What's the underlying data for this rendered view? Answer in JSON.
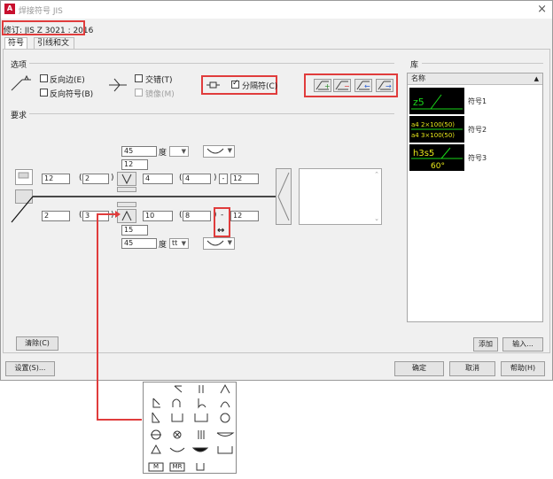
{
  "window": {
    "title": "焊接符号 JIS",
    "app_icon": "A",
    "close": "×"
  },
  "revision": "修订: JIS Z 3021 : 2016",
  "tabs": [
    {
      "label": "符号"
    },
    {
      "label": "引线和文字"
    }
  ],
  "options": {
    "heading": "选项",
    "reverse_side": "反向边(E)",
    "reverse_symbol": "反向符号(B)",
    "staggered": "交错(T)",
    "mirror": "镜像(M)",
    "separator": "分隔符(C)"
  },
  "requirements": {
    "heading": "要求",
    "upper": {
      "angle": "45",
      "angle_unit": "度",
      "root_gap": "12",
      "depth": "12",
      "size": "2",
      "length": "4",
      "dash": "-",
      "pitch": "12"
    },
    "lower": {
      "depth": "2",
      "size": "3",
      "length": "10",
      "pitch_count": "8",
      "dash": "-",
      "pitch": "12",
      "root_gap": "15",
      "angle": "45",
      "angle_unit": "度",
      "finish": "tt",
      "arrow_label": "↔"
    },
    "clear_button": "清除(C)"
  },
  "library": {
    "heading": "库",
    "column": "名称",
    "items": [
      {
        "name": "符号1",
        "line1": "z5",
        "line2": ""
      },
      {
        "name": "符号2",
        "line1": "a4  2×100(50)",
        "line2": "a4  3×100(50)"
      },
      {
        "name": "符号3",
        "line1": "h3s5",
        "line2": "60°"
      }
    ],
    "add_button": "添加",
    "import_button": "输入..."
  },
  "footer": {
    "settings": "设置(S)...",
    "ok": "确定",
    "cancel": "取消",
    "help": "帮助(H)"
  },
  "palette": {
    "row3": [
      "M",
      "MR"
    ]
  },
  "colors": {
    "annotation_red": "#e03c3c",
    "thumb_green": "#19d619",
    "thumb_yellow": "#e8e81a"
  }
}
